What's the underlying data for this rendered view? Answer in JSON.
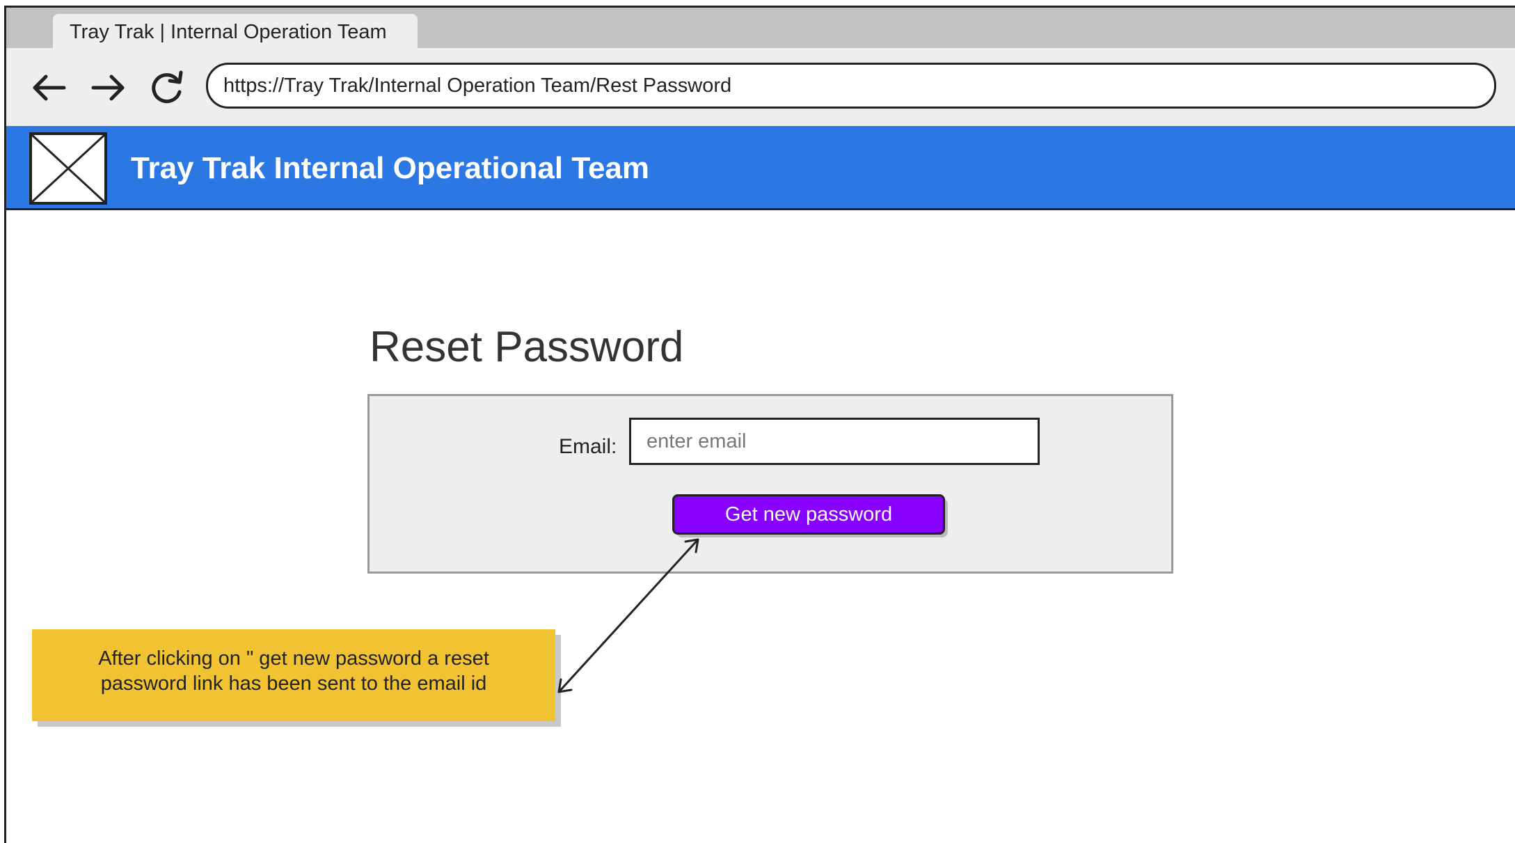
{
  "browser": {
    "tab_title": "Tray Trak | Internal Operation Team",
    "url": "https://Tray Trak/Internal Operation Team/Rest Password",
    "back_icon": "arrow-left-icon",
    "forward_icon": "arrow-right-icon",
    "reload_icon": "reload-icon"
  },
  "header": {
    "logo_icon": "image-placeholder-icon",
    "title": "Tray Trak Internal Operational Team",
    "background_color": "#2b78e4"
  },
  "main": {
    "title": "Reset Password",
    "email_label": "Email:",
    "email_placeholder": "enter email",
    "email_value": "",
    "submit_label": "Get new password",
    "submit_color": "#8800ff"
  },
  "annotation": {
    "text": "After clicking on \" get new password a reset password link has been sent to the email id",
    "color": "#f1c232"
  }
}
